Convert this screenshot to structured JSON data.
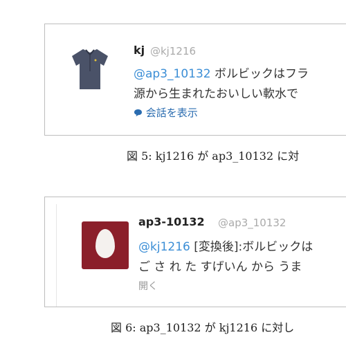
{
  "figure5": {
    "tweet": {
      "name": "kj",
      "handle": "@kj1216",
      "mention": "@ap3_10132",
      "text_line1": " ボルビックはフラ",
      "text_line2": "源から生まれたおいしい軟水で",
      "show_conversation": "会話を表示"
    },
    "caption": "図 5:  kj1216 が ap3_10132 に対"
  },
  "figure6": {
    "tweet": {
      "name": "ap3-10132",
      "handle": "@ap3_10132",
      "mention": "@kj1216",
      "text_line1": " [変換後]:ボルビックは",
      "text_line2": "ご さ れ た すげいん から うま",
      "open_label": "開く"
    },
    "caption": "図 6:  ap3_10132 が kj1216 に対し"
  },
  "colors": {
    "egg_avatar": "#8b1f2a",
    "mention": "#3b8ed6"
  }
}
